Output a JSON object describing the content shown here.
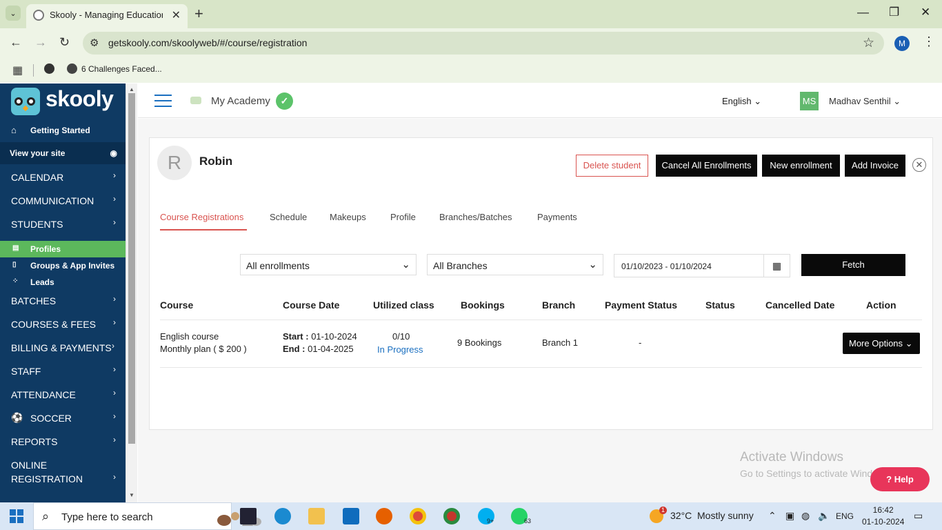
{
  "browser": {
    "tab_title": "Skooly - Managing Educational",
    "url": "getskooly.com/skoolyweb/#/course/registration",
    "bookmark": "6 Challenges Faced...",
    "profile_initial": "M"
  },
  "sidebar": {
    "logo_text": "skooly",
    "getting_started": "Getting Started",
    "view_site": "View your site",
    "menu": {
      "calendar": "CALENDAR",
      "communication": "COMMUNICATION",
      "students": "STUDENTS",
      "batches": "BATCHES",
      "courses_fees": "COURSES & FEES",
      "billing": "BILLING & PAYMENTS",
      "staff": "STAFF",
      "attendance": "ATTENDANCE",
      "soccer": "SOCCER",
      "reports": "REPORTS",
      "online_reg_1": "ONLINE",
      "online_reg_2": "REGISTRATION"
    },
    "sub": {
      "profiles": "Profiles",
      "groups": "Groups & App Invites",
      "leads": "Leads"
    }
  },
  "header": {
    "academy": "My Academy",
    "language": "English",
    "user_initials": "MS",
    "user_name": "Madhav Senthil"
  },
  "student": {
    "initial": "R",
    "name": "Robin"
  },
  "actions": {
    "delete": "Delete student",
    "cancel_all": "Cancel All Enrollments",
    "new_enrollment": "New enrollment",
    "add_invoice": "Add Invoice"
  },
  "tabs": {
    "course_registrations": "Course Registrations",
    "schedule": "Schedule",
    "makeups": "Makeups",
    "profile": "Profile",
    "branches": "Branches/Batches",
    "payments": "Payments"
  },
  "filters": {
    "enrollments": "All enrollments",
    "branches": "All Branches",
    "date_range": "01/10/2023 - 01/10/2024",
    "fetch": "Fetch"
  },
  "table": {
    "headers": {
      "course": "Course",
      "course_date": "Course Date",
      "utilized": "Utilized class",
      "bookings": "Bookings",
      "branch": "Branch",
      "payment_status": "Payment Status",
      "status": "Status",
      "cancelled_date": "Cancelled Date",
      "action": "Action"
    },
    "row": {
      "course": "English course",
      "plan": "Monthly plan ( $ 200 )",
      "start_label": "Start :",
      "start": "01-10-2024",
      "end_label": "End :",
      "end": "01-04-2025",
      "utilized": "0/10",
      "progress": "In Progress",
      "bookings": "9 Bookings",
      "branch": "Branch 1",
      "payment_status": "-",
      "action": "More Options"
    }
  },
  "watermark": {
    "line1": "Activate Windows",
    "line2": "Go to Settings to activate Windows."
  },
  "help": "Help",
  "taskbar": {
    "search_placeholder": "Type here to search",
    "weather_temp": "32°C",
    "weather_desc": "Mostly sunny",
    "lang": "ENG",
    "time": "16:42",
    "date": "01-10-2024",
    "whatsapp_badge": "63",
    "skype_badge": "9+",
    "weather_badge": "1"
  },
  "colors": {
    "sidebar_bg": "#0f3a63",
    "active_green": "#5cb85c",
    "accent_red": "#d9534f",
    "link_blue": "#1a6fc0"
  }
}
